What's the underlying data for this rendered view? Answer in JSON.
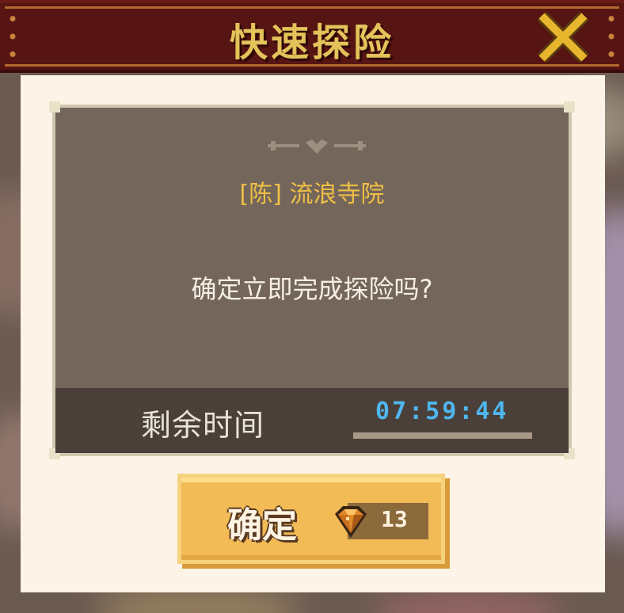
{
  "header": {
    "title": "快速探险",
    "close_icon": "close-x-icon",
    "colors": {
      "bar": "#561412",
      "title": "#e3c35a",
      "close": "#e8b62c"
    }
  },
  "card": {
    "location": "[陈] 流浪寺院",
    "question": "确定立即完成探险吗?",
    "time_label": "剩余时间",
    "time_value": "07:59:44",
    "time_remaining_fraction": 1.0,
    "colors": {
      "location": "#f0bf45",
      "time_value": "#4fb6ee"
    }
  },
  "confirm": {
    "label": "确定",
    "cost_icon": "gem-icon",
    "cost": "13",
    "colors": {
      "button": "#f3bb56"
    }
  }
}
